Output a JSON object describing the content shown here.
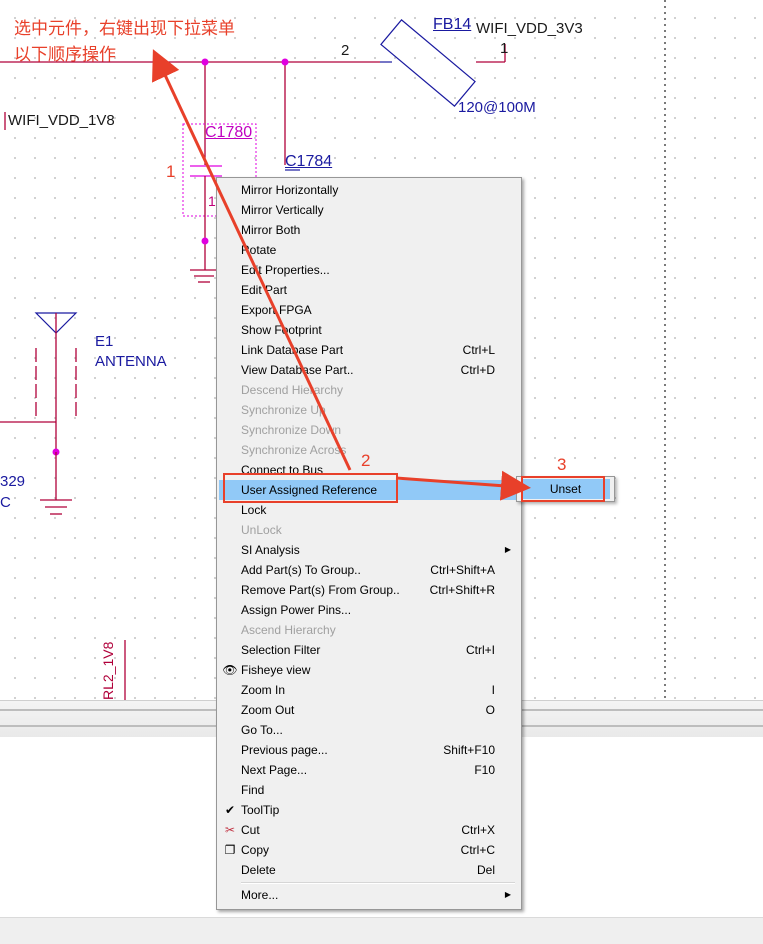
{
  "annotation": {
    "line1": "选中元件，右键出现下拉菜单",
    "line2": "以下顺序操作",
    "step1": "1",
    "step2": "2",
    "step3": "3"
  },
  "schematic": {
    "fb14_ref": "FB14",
    "fb14_value": "120@100M",
    "net_3v3": "WIFI_VDD_3V3",
    "net_1v8": "WIFI_VDD_1V8",
    "pin2": "2",
    "pin1": "1",
    "c1780_ref": "C1780",
    "c1784_ref": "C1784",
    "c1780_pin": "1",
    "c1780_pin1": "1",
    "e1_ref": "E1",
    "e1_value": "ANTENNA",
    "partial_329": "329",
    "partial_c": "C",
    "partial_rl2": "RL2_1V8"
  },
  "menu": {
    "items": [
      {
        "label": "Mirror Horizontally",
        "shortcut": "",
        "disabled": false
      },
      {
        "label": "Mirror Vertically",
        "shortcut": "",
        "disabled": false
      },
      {
        "label": "Mirror Both",
        "shortcut": "",
        "disabled": false
      },
      {
        "label": "Rotate",
        "shortcut": "",
        "disabled": false
      },
      {
        "label": "Edit Properties...",
        "shortcut": "",
        "disabled": false
      },
      {
        "label": "Edit Part",
        "shortcut": "",
        "disabled": false
      },
      {
        "label": "Export FPGA",
        "shortcut": "",
        "disabled": false
      },
      {
        "label": "Show Footprint",
        "shortcut": "",
        "disabled": false
      },
      {
        "label": "Link Database Part",
        "shortcut": "Ctrl+L",
        "disabled": false
      },
      {
        "label": "View Database Part..",
        "shortcut": "Ctrl+D",
        "disabled": false
      },
      {
        "label": "Descend Hierarchy",
        "shortcut": "",
        "disabled": true
      },
      {
        "label": "Synchronize Up",
        "shortcut": "",
        "disabled": true
      },
      {
        "label": "Synchronize Down",
        "shortcut": "",
        "disabled": true
      },
      {
        "label": "Synchronize Across",
        "shortcut": "",
        "disabled": true
      },
      {
        "label": "Connect to Bus",
        "shortcut": "",
        "disabled": false
      },
      {
        "label": "User Assigned Reference",
        "shortcut": "",
        "disabled": false,
        "highlight": true,
        "submenu": true
      },
      {
        "label": "Lock",
        "shortcut": "",
        "disabled": false
      },
      {
        "label": "UnLock",
        "shortcut": "",
        "disabled": true
      },
      {
        "label": "SI Analysis",
        "shortcut": "",
        "disabled": false,
        "submenu": true
      },
      {
        "label": "Add Part(s) To Group..",
        "shortcut": "Ctrl+Shift+A",
        "disabled": false
      },
      {
        "label": "Remove Part(s) From Group..",
        "shortcut": "Ctrl+Shift+R",
        "disabled": false
      },
      {
        "label": "Assign Power Pins...",
        "shortcut": "",
        "disabled": false
      },
      {
        "label": "Ascend Hierarchy",
        "shortcut": "",
        "disabled": true
      },
      {
        "label": "Selection Filter",
        "shortcut": "Ctrl+I",
        "disabled": false
      },
      {
        "label": "Fisheye view",
        "shortcut": "",
        "disabled": false,
        "icon": "eye-icon"
      },
      {
        "label": "Zoom In",
        "shortcut": "I",
        "disabled": false
      },
      {
        "label": "Zoom Out",
        "shortcut": "O",
        "disabled": false
      },
      {
        "label": "Go To...",
        "shortcut": "",
        "disabled": false
      },
      {
        "label": "Previous page...",
        "shortcut": "Shift+F10",
        "disabled": false
      },
      {
        "label": "Next Page...",
        "shortcut": "F10",
        "disabled": false
      },
      {
        "label": "Find",
        "shortcut": "",
        "disabled": false
      },
      {
        "label": "ToolTip",
        "shortcut": "",
        "disabled": false,
        "icon": "checkmark-icon"
      },
      {
        "label": "Cut",
        "shortcut": "Ctrl+X",
        "disabled": false,
        "icon": "scissors-icon"
      },
      {
        "label": "Copy",
        "shortcut": "Ctrl+C",
        "disabled": false,
        "icon": "copy-icon"
      },
      {
        "label": "Delete",
        "shortcut": "Del",
        "disabled": false
      },
      {
        "label": "More...",
        "shortcut": "",
        "disabled": false,
        "submenu": true
      }
    ]
  },
  "submenu": {
    "item": "Unset"
  },
  "colors": {
    "annotation": "#e8402a",
    "highlight": "#91c9f7",
    "wire": "#b0003a",
    "junction": "#e000e0"
  }
}
